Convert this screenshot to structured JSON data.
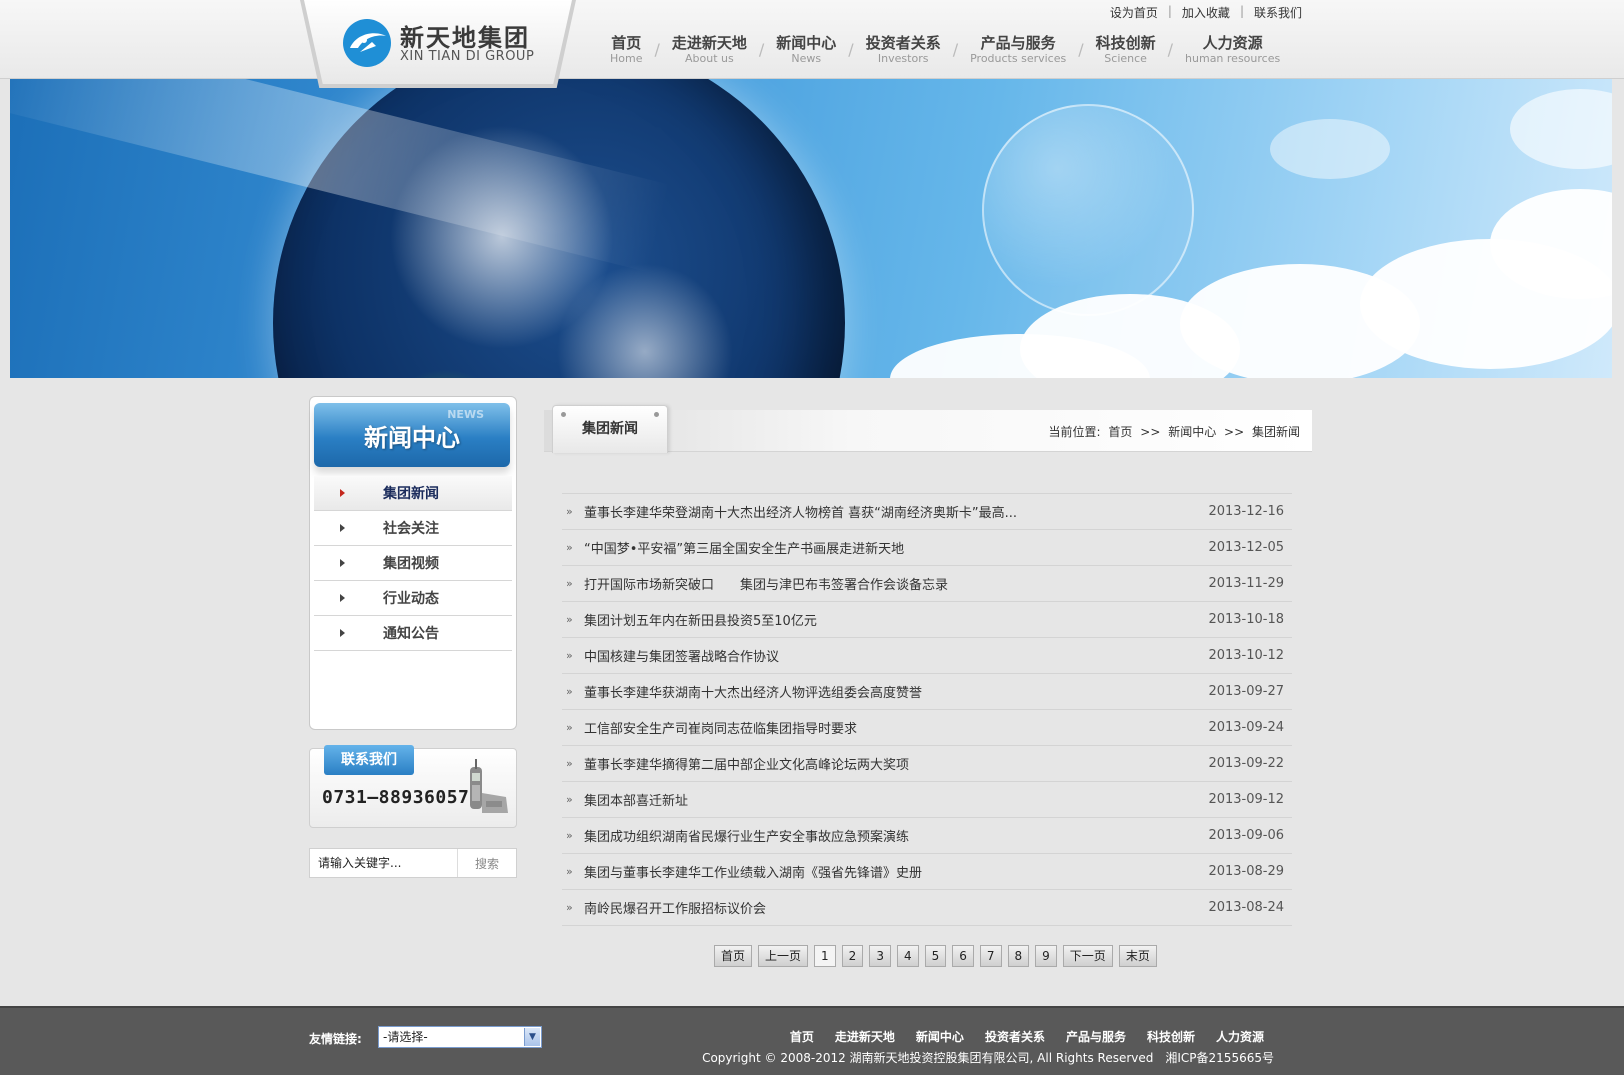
{
  "header": {
    "logo_cn": "新天地集团",
    "logo_en": "XIN TIAN DI GROUP",
    "top_links": [
      "设为首页",
      "加入收藏",
      "联系我们"
    ],
    "nav": [
      {
        "cn": "首页",
        "en": "Home"
      },
      {
        "cn": "走进新天地",
        "en": "About us"
      },
      {
        "cn": "新闻中心",
        "en": "News"
      },
      {
        "cn": "投资者关系",
        "en": "Investors"
      },
      {
        "cn": "产品与服务",
        "en": "Products services"
      },
      {
        "cn": "科技创新",
        "en": "Science"
      },
      {
        "cn": "人力资源",
        "en": "human resources"
      }
    ]
  },
  "sidebar": {
    "title": "新闻中心",
    "title_tag": "NEWS",
    "items": [
      {
        "label": "集团新闻",
        "active": true
      },
      {
        "label": "社会关注",
        "active": false
      },
      {
        "label": "集团视频",
        "active": false
      },
      {
        "label": "行业动态",
        "active": false
      },
      {
        "label": "通知公告",
        "active": false
      }
    ],
    "contact_label": "联系我们",
    "contact_phone": "0731—88936057",
    "search_placeholder": "请输入关键字...",
    "search_button": "搜索"
  },
  "main": {
    "section_title": "集团新闻",
    "breadcrumb": {
      "prefix": "当前位置:",
      "items": [
        "首页",
        "新闻中心",
        "集团新闻"
      ],
      "separator": ">>"
    },
    "bullet": "»",
    "news": [
      {
        "title": "董事长李建华荣登湖南十大杰出经济人物榜首 喜获“湖南经济奥斯卡”最高...",
        "date": "2013-12-16"
      },
      {
        "title": "“中国梦•平安福”第三届全国安全生产书画展走进新天地",
        "date": "2013-12-05"
      },
      {
        "title": "打开国际市场新突破口　　集团与津巴布韦签署合作会谈备忘录",
        "date": "2013-11-29"
      },
      {
        "title": "集团计划五年内在新田县投资5至10亿元",
        "date": "2013-10-18"
      },
      {
        "title": "中国核建与集团签署战略合作协议",
        "date": "2013-10-12"
      },
      {
        "title": "董事长李建华获湖南十大杰出经济人物评选组委会高度赞誉",
        "date": "2013-09-27"
      },
      {
        "title": "工信部安全生产司崔岗同志莅临集团指导时要求",
        "date": "2013-09-24"
      },
      {
        "title": "董事长李建华摘得第二届中部企业文化高峰论坛两大奖项",
        "date": "2013-09-22"
      },
      {
        "title": "集团本部喜迁新址",
        "date": "2013-09-12"
      },
      {
        "title": "集团成功组织湖南省民爆行业生产安全事故应急预案演练",
        "date": "2013-09-06"
      },
      {
        "title": "集团与董事长李建华工作业绩载入湖南《强省先锋谱》史册",
        "date": "2013-08-29"
      },
      {
        "title": "南岭民爆召开工作服招标议价会",
        "date": "2013-08-24"
      }
    ],
    "pager": {
      "first": "首页",
      "prev": "上一页",
      "pages": [
        "1",
        "2",
        "3",
        "4",
        "5",
        "6",
        "7",
        "8",
        "9"
      ],
      "next": "下一页",
      "last": "末页"
    }
  },
  "footer": {
    "friend_label": "友情链接:",
    "friend_select": "-请选择-",
    "nav": [
      "首页",
      "走进新天地",
      "新闻中心",
      "投资者关系",
      "产品与服务",
      "科技创新",
      "人力资源"
    ],
    "copyright": "Copyright © 2008-2012 湖南新天地投资控股集团有限公司, All Rights Reserved　湘ICP备2155665号"
  },
  "colors": {
    "accent_blue": "#2a7fc4",
    "footer_bg": "#595959",
    "active_arrow": "#c4271d"
  }
}
